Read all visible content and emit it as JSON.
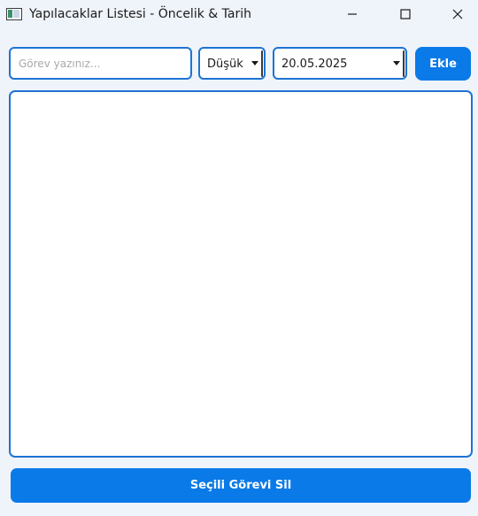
{
  "window": {
    "title": "Yapılacaklar Listesi - Öncelik & Tarih",
    "icon": "app-window-icon",
    "controls": {
      "minimize_icon": "minimize-icon",
      "maximize_icon": "maximize-icon",
      "close_icon": "close-icon"
    }
  },
  "form": {
    "task_input": {
      "value": "",
      "placeholder": "Görev yazınız..."
    },
    "priority": {
      "selected": "Düşük"
    },
    "date": {
      "selected": "20.05.2025"
    },
    "add_label": "Ekle"
  },
  "task_list": {
    "items": []
  },
  "actions": {
    "delete_selected_label": "Seçili Görevi Sil"
  },
  "colors": {
    "accent": "#0a7ae8",
    "border": "#1e73d4",
    "background": "#eff3fa"
  }
}
